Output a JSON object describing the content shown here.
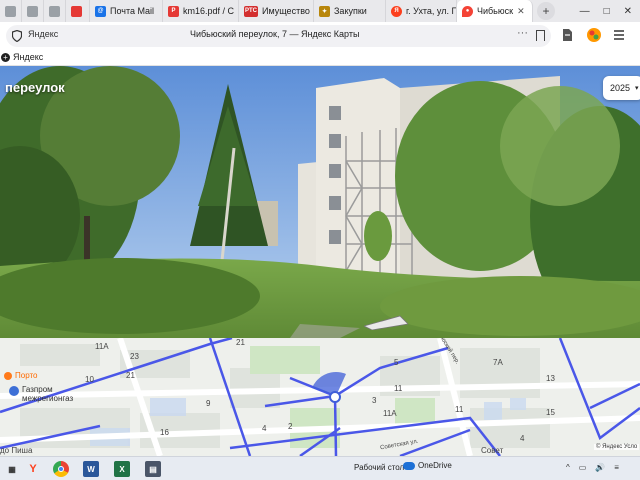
{
  "tabs": [
    {
      "label": "",
      "icon": "page-icon",
      "color": "#888"
    },
    {
      "label": "",
      "icon": "page-icon",
      "color": "#888"
    },
    {
      "label": "",
      "icon": "page-icon",
      "color": "#888"
    },
    {
      "label": "Почта Mail",
      "icon": "mail-icon",
      "color": "#1a73e8"
    },
    {
      "label": "km16.pdf / С",
      "icon": "pdf-icon",
      "color": "#e53935"
    },
    {
      "label": "Имущество",
      "icon": "rts-icon",
      "color": "#d32f2f"
    },
    {
      "label": "Закупки",
      "icon": "emblem-icon",
      "color": "#b8860b"
    },
    {
      "label": "г. Ухта, ул. П",
      "icon": "yandex-icon",
      "color": "#fc3f1d"
    },
    {
      "label": "Чибьюск",
      "icon": "map-pin-icon",
      "color": "#f44336",
      "active": true
    }
  ],
  "window_controls": [
    "—",
    "□",
    "✕"
  ],
  "address_bar": {
    "host": "Яндекс",
    "title": "Чибьюский переулок, 7 — Яндекс Карты",
    "more": "···"
  },
  "bookmarks_bar": {
    "label": "Яндекс"
  },
  "panorama": {
    "caption": "переулок",
    "year": "2025",
    "year_caret": "▾"
  },
  "map": {
    "labels": [
      {
        "text": "11А",
        "key": "a"
      },
      {
        "text": "21",
        "key": "b"
      },
      {
        "text": "10",
        "key": "c"
      },
      {
        "text": "23",
        "key": "d"
      },
      {
        "text": "21",
        "key": "e"
      },
      {
        "text": "2",
        "key": "f"
      },
      {
        "text": "9",
        "key": "g"
      },
      {
        "text": "4",
        "key": "h"
      },
      {
        "text": "16",
        "key": "i"
      },
      {
        "text": "7А",
        "key": "j"
      },
      {
        "text": "11",
        "key": "k"
      },
      {
        "text": "13",
        "key": "l"
      },
      {
        "text": "15",
        "key": "m"
      },
      {
        "text": "11А",
        "key": "n"
      },
      {
        "text": "4",
        "key": "o"
      },
      {
        "text": "5",
        "key": "p"
      },
      {
        "text": "3",
        "key": "q"
      },
      {
        "text": "11",
        "key": "r"
      },
      {
        "text": "Чибьюский пер.",
        "key": "s"
      },
      {
        "text": "Советская ул.",
        "key": "t"
      },
      {
        "text": "Совет",
        "key": "u"
      },
      {
        "text": "до Пиша",
        "key": "v"
      }
    ],
    "poi_porto": "Порто",
    "poi_gazprom": "Газпром\nмежрегионгаз",
    "copyright": "© Яндекс  Усло"
  },
  "taskbar": {
    "desktop": "Рабочий стол",
    "onedrive": "OneDrive",
    "tray": [
      "^",
      "▭",
      "🔊",
      "≡"
    ]
  }
}
